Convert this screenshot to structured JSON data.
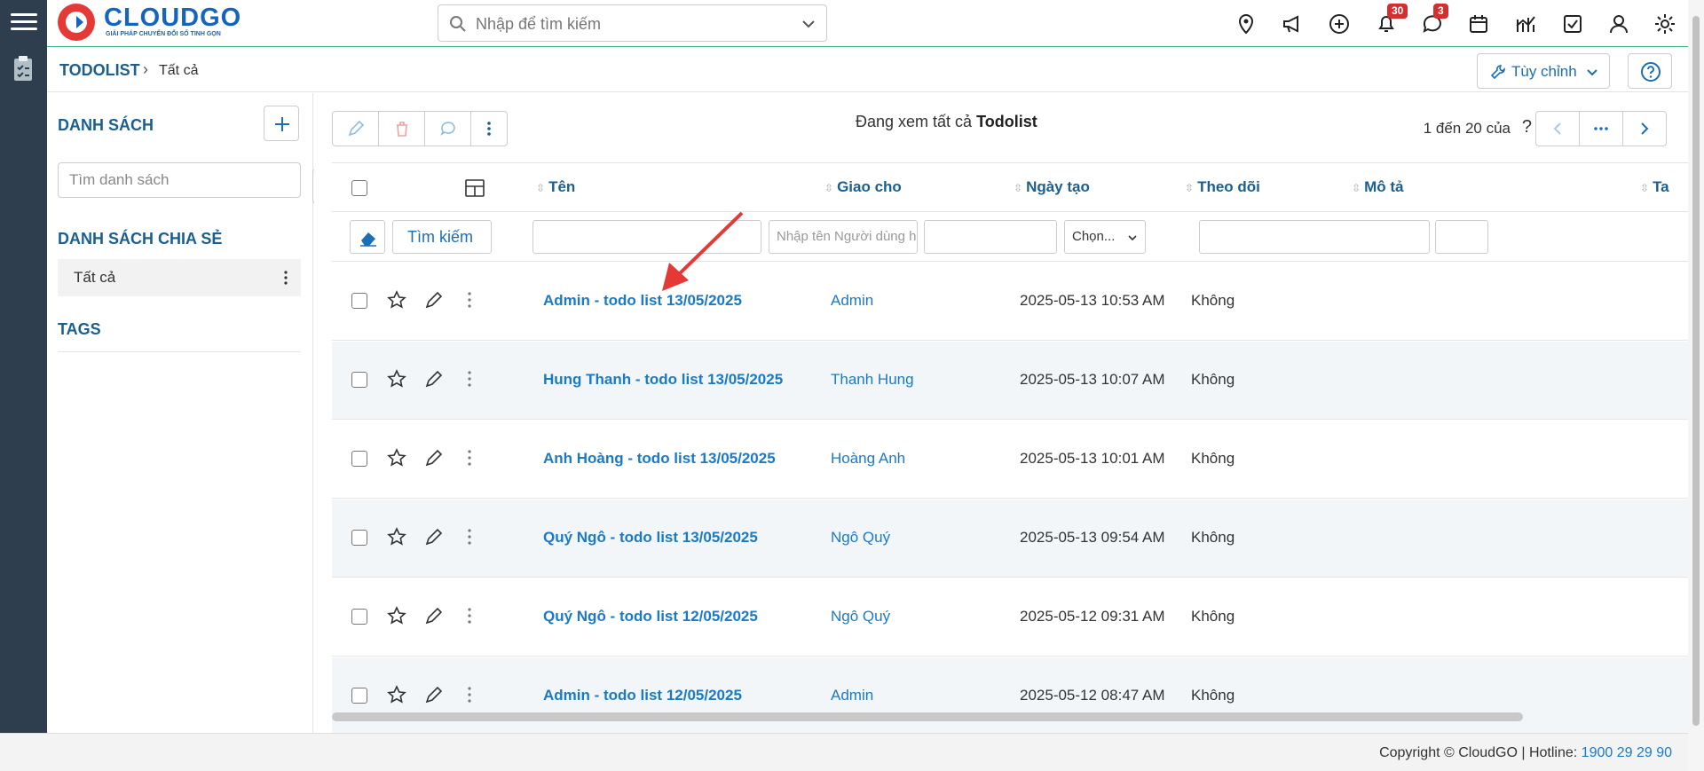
{
  "app": {
    "brand_name": "CLOUDGO",
    "brand_tagline": "GIẢI PHÁP CHUYỂN ĐỔI SỐ TINH GỌN",
    "search_placeholder": "Nhập để tìm kiếm",
    "notifications_count": "30",
    "messages_count": "3"
  },
  "breadcrumb": {
    "root": "TODOLIST",
    "current": "Tất cả",
    "customize_label": "Tùy chỉnh"
  },
  "sidebar": {
    "lists_title": "DANH SÁCH",
    "search_placeholder": "Tìm danh sách",
    "shared_title": "DANH SÁCH CHIA SẺ",
    "shared_items": [
      {
        "label": "Tất cả"
      }
    ],
    "tags_title": "TAGS"
  },
  "toolbar": {
    "viewing_prefix": "Đang xem tất cả",
    "viewing_module": "Todolist",
    "paging_text": "1 đến 20 của",
    "paging_unknown": "?"
  },
  "table": {
    "columns": [
      "Tên",
      "Giao cho",
      "Ngày tạo",
      "Theo dõi",
      "Mô tả",
      "Ta"
    ],
    "filter": {
      "search_button": "Tìm kiếm",
      "assignee_placeholder": "Nhập tên Người dùng hoặc nhóm",
      "follow_select": "Chọn..."
    },
    "rows": [
      {
        "name": "Admin - todo list 13/05/2025",
        "assigned": "Admin",
        "created": "2025-05-13 10:53 AM",
        "follow": "Không"
      },
      {
        "name": "Hung Thanh - todo list 13/05/2025",
        "assigned": "Thanh Hung",
        "created": "2025-05-13 10:07 AM",
        "follow": "Không"
      },
      {
        "name": "Anh Hoàng - todo list 13/05/2025",
        "assigned": "Hoàng Anh",
        "created": "2025-05-13 10:01 AM",
        "follow": "Không"
      },
      {
        "name": "Quý Ngô - todo list 13/05/2025",
        "assigned": "Ngô Quý",
        "created": "2025-05-13 09:54 AM",
        "follow": "Không"
      },
      {
        "name": "Quý Ngô - todo list 12/05/2025",
        "assigned": "Ngô Quý",
        "created": "2025-05-12 09:31 AM",
        "follow": "Không"
      },
      {
        "name": "Admin - todo list 12/05/2025",
        "assigned": "Admin",
        "created": "2025-05-12 08:47 AM",
        "follow": "Không"
      }
    ]
  },
  "footer": {
    "copyright": "Copyright © CloudGO",
    "hotline_label": "Hotline:",
    "hotline_number": "1900 29 29 90"
  },
  "colors": {
    "rail": "#2f3e4e",
    "accent": "#1a5f8f",
    "link": "#1a7ac8",
    "badge": "#d32f2f",
    "annotation_arrow": "#e53935"
  }
}
